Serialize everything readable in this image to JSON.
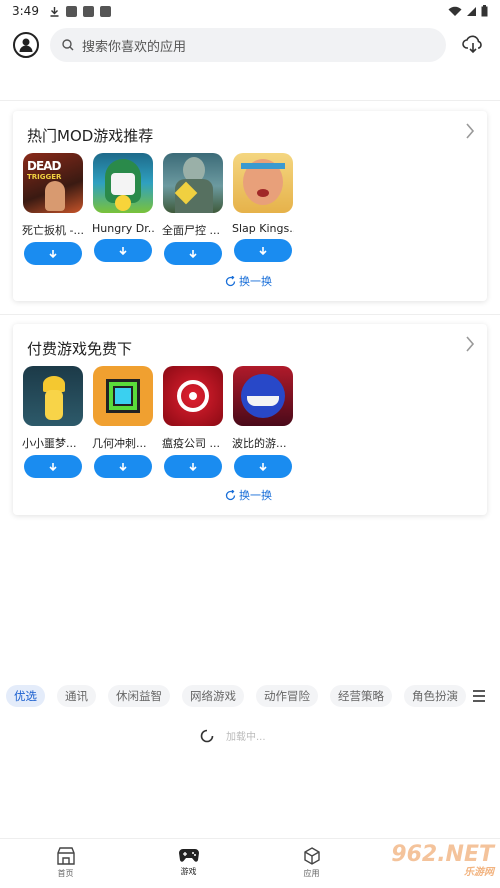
{
  "status_bar": {
    "time": "3:49"
  },
  "search": {
    "placeholder": "搜索你喜欢的应用"
  },
  "sections": [
    {
      "title": "热门MOD游戏推荐",
      "games": [
        {
          "name": "死亡扳机 -...",
          "icon": "dead-trigger-icon"
        },
        {
          "name": "Hungry Dr...",
          "icon": "hungry-dragon-icon"
        },
        {
          "name": "全面尸控 ...",
          "icon": "zombie-game-icon"
        },
        {
          "name": "Slap Kings...",
          "icon": "slap-kings-icon"
        }
      ],
      "refresh_label": "换一换"
    },
    {
      "title": "付费游戏免费下",
      "games": [
        {
          "name": "小小噩梦...",
          "icon": "little-nightmares-icon"
        },
        {
          "name": "几何冲刺...",
          "icon": "geometry-dash-icon"
        },
        {
          "name": "瘟疫公司 ...",
          "icon": "plague-inc-icon"
        },
        {
          "name": "波比的游...",
          "icon": "poppy-playtime-icon"
        }
      ],
      "refresh_label": "换一换"
    }
  ],
  "category_tabs": [
    "优选",
    "通讯",
    "休闲益智",
    "网络游戏",
    "动作冒险",
    "经营策略",
    "角色扮演"
  ],
  "active_tab": "优选",
  "loading_text": "加载中...",
  "bottom_nav": [
    {
      "label": "首页",
      "icon": "home-store-icon"
    },
    {
      "label": "游戏",
      "icon": "gamepad-icon"
    },
    {
      "label": "应用",
      "icon": "cube-icon"
    }
  ],
  "watermark": {
    "main": "962.NET",
    "sub": "乐游网"
  },
  "colors": {
    "accent": "#1a8cf0",
    "tab_active_text": "#1a5fcf"
  }
}
